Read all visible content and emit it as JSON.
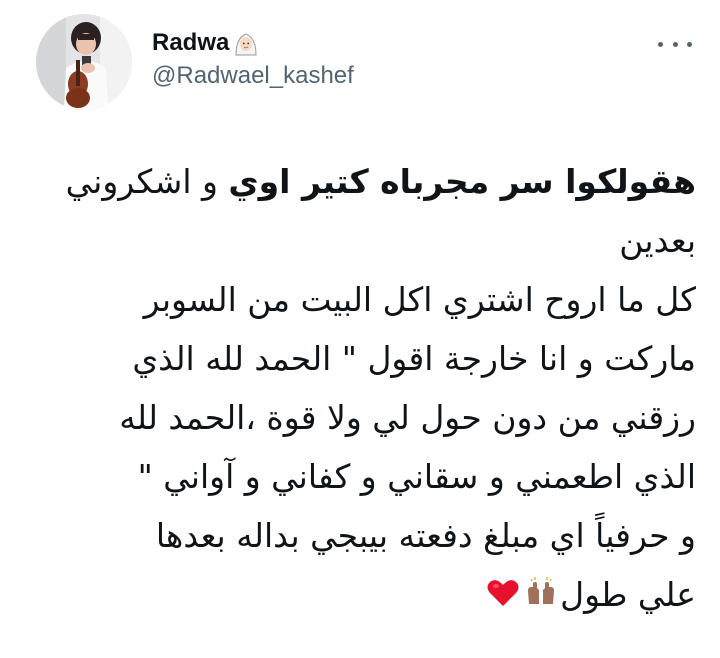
{
  "user": {
    "display_name": "Radwa",
    "handle": "@Radwael_kashef",
    "name_emoji": "woman-with-headscarf-emoji"
  },
  "more_icon": "more-horizontal-icon",
  "tweet": {
    "lines": [
      {
        "bold": "هقولكوا سر مجرباه كتير اوي",
        "regular": " و اشكروني"
      },
      {
        "regular": "بعدين"
      },
      {
        "regular": "كل ما اروح اشتري اكل البيت من السوبر"
      },
      {
        "regular": "ماركت و انا خارجة اقول \" الحمد لله الذي"
      },
      {
        "regular": "رزقني من دون حول لي ولا قوة ،الحمد لله"
      },
      {
        "regular": "الذي اطعمني و سقاني و كفاني و آواني \""
      },
      {
        "regular": "و حرفياً اي مبلغ دفعته بيبجي بداله بعدها"
      },
      {
        "regular": "علي طول"
      }
    ],
    "trailing_emojis": [
      "raising-hands-emoji",
      "red-heart-emoji"
    ]
  },
  "colors": {
    "text": "#0f1419",
    "secondary": "#536471",
    "heart": "#e8112d",
    "skin": "#a0715a"
  }
}
